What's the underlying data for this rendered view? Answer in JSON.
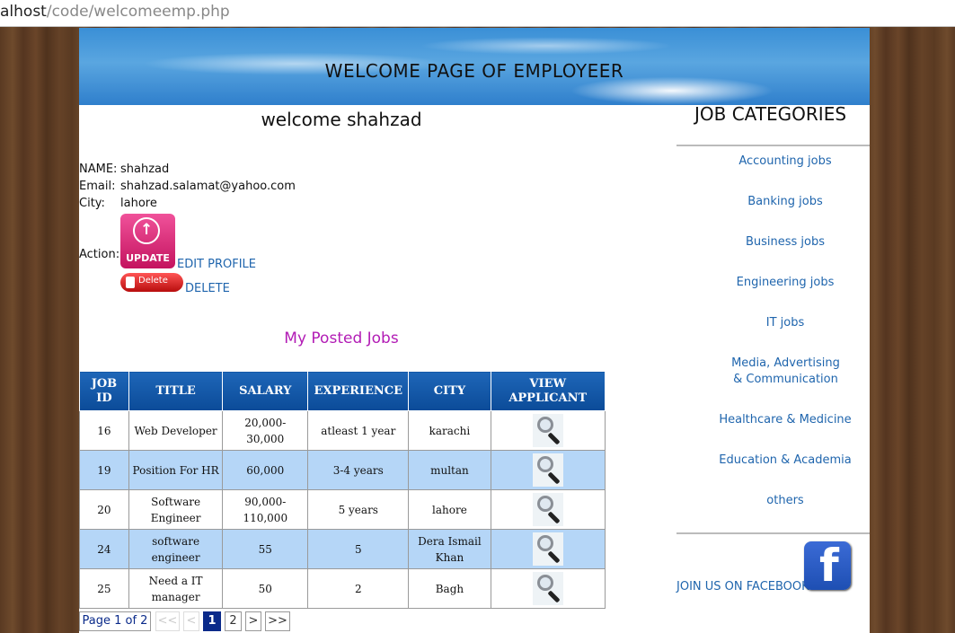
{
  "browser": {
    "url_prefix": "alhost",
    "url_rest": "/code/welcomeemp.php"
  },
  "banner": {
    "title": "WELCOME PAGE OF EMPLOYEER"
  },
  "welcome": {
    "prefix": "welcome",
    "name": "shahzad"
  },
  "profile": {
    "name_label": "NAME:",
    "name_value": "shahzad",
    "email_label": "Email:",
    "email_value": "shahzad.salamat@yahoo.com",
    "city_label": "City:",
    "city_value": "lahore",
    "action_label": "Action:"
  },
  "actions": {
    "update_button_text": "UPDATE",
    "edit_link": "EDIT PROFILE",
    "delete_button_text": "Delete",
    "delete_link": "DELETE"
  },
  "posted_jobs": {
    "title": "My Posted Jobs",
    "headers": [
      "JOB ID",
      "TITLE",
      "SALARY",
      "EXPERIENCE",
      "CITY",
      "VIEW APPLICANT"
    ],
    "rows": [
      {
        "id": "16",
        "title": "Web Developer",
        "salary": "20,000-30,000",
        "experience": "atleast 1 year",
        "city": "karachi"
      },
      {
        "id": "19",
        "title": "Position For HR",
        "salary": "60,000",
        "experience": "3-4 years",
        "city": "multan"
      },
      {
        "id": "20",
        "title": "Software Engineer",
        "salary": "90,000-110,000",
        "experience": "5 years",
        "city": "lahore"
      },
      {
        "id": "24",
        "title": "software engineer",
        "salary": "55",
        "experience": "5",
        "city": "Dera Ismail Khan"
      },
      {
        "id": "25",
        "title": "Need a IT manager",
        "salary": "50",
        "experience": "2",
        "city": "Bagh"
      }
    ]
  },
  "pagination": {
    "info": "Page 1 of 2",
    "first": "<<",
    "prev": "<",
    "page1": "1",
    "page2": "2",
    "next": ">",
    "last": ">>"
  },
  "sidebar": {
    "title": "JOB CATEGORIES",
    "categories": [
      "Accounting jobs",
      "Banking jobs",
      "Business jobs",
      "Engineering jobs",
      "IT jobs",
      "Media, Advertising & Communication",
      "Healthcare & Medicine",
      "Education & Academia",
      "others"
    ],
    "facebook_text": "JOIN US ON FACEBOOK",
    "facebook_icon": "f"
  },
  "colors": {
    "header_blue": "#0b4b98",
    "row_alt": "#b5d6f7",
    "link": "#1f65ad",
    "posted_title": "#b21cb5"
  }
}
